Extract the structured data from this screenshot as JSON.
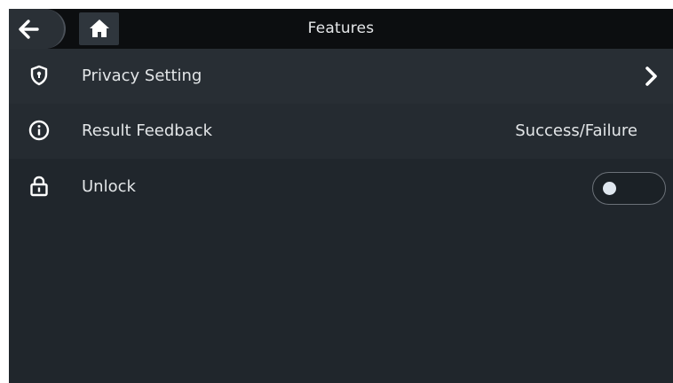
{
  "header": {
    "title": "Features",
    "back_icon": "arrow-left-icon",
    "home_icon": "home-icon"
  },
  "rows": [
    {
      "label": "Privacy Setting",
      "icon": "shield-icon",
      "trailing": "chevron-right-icon"
    },
    {
      "label": "Result Feedback",
      "icon": "info-circle-icon",
      "value": "Success/Failure"
    },
    {
      "label": "Unlock",
      "icon": "lock-icon",
      "toggle_on": false
    }
  ],
  "colors": {
    "background": "#20262c",
    "header": "#0c0e10",
    "text": "#e3e6e8"
  }
}
